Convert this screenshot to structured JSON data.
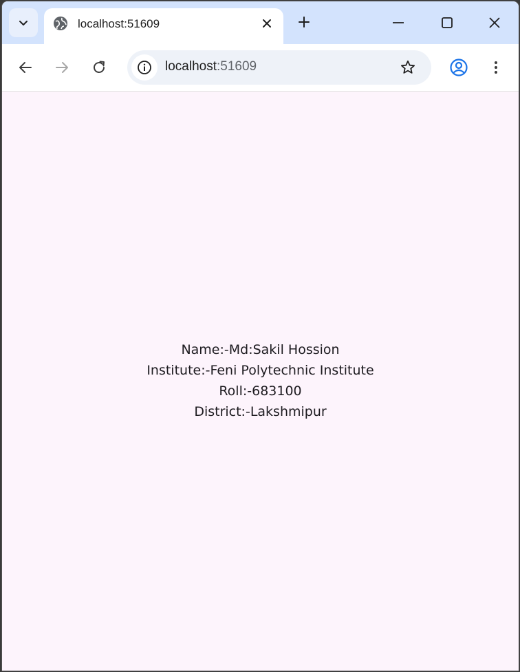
{
  "browser": {
    "tab": {
      "title": "localhost:51609"
    },
    "omnibox": {
      "host": "localhost",
      "port": ":51609"
    }
  },
  "page": {
    "lines": [
      "Name:-Md:Sakil Hossion",
      "Institute:-Feni Polytechnic Institute",
      "Roll:-683100",
      "District:-Lakshmipur"
    ]
  },
  "colors": {
    "tabstrip": "#d3e3fd",
    "page_background": "#fdf4fc",
    "profile_icon": "#1a73e8"
  },
  "icons": [
    "chevron-down-icon",
    "globe-icon",
    "close-icon",
    "plus-icon",
    "minimize-icon",
    "maximize-icon",
    "window-close-icon",
    "back-arrow-icon",
    "forward-arrow-icon",
    "reload-icon",
    "info-icon",
    "star-icon",
    "profile-icon",
    "more-vertical-icon"
  ]
}
